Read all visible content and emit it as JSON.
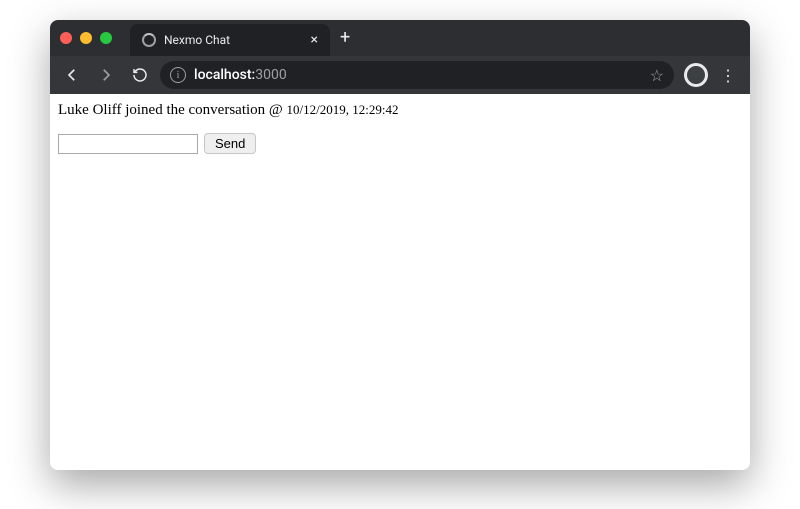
{
  "browser": {
    "tab_title": "Nexmo Chat",
    "url_host": "localhost:",
    "url_port": "3000",
    "new_tab_symbol": "+",
    "close_tab_symbol": "×",
    "star_symbol": "☆",
    "menu_symbol": "⋮"
  },
  "page": {
    "message_user": "Luke Oliff joined the conversation",
    "message_at": " @ ",
    "message_time": "10/12/2019, 12:29:42",
    "input_value": "",
    "send_label": "Send"
  }
}
